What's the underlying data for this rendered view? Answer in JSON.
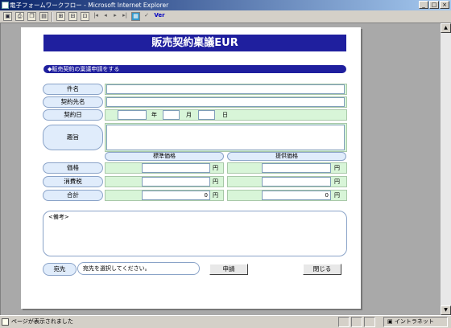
{
  "window": {
    "title": "電子フォームワークフロー - Microsoft Internet Explorer",
    "buttons": [
      "_",
      "□",
      "×"
    ]
  },
  "toolbar": {
    "zoom_version_label": "Ver",
    "icons": [
      "save-icon",
      "print-icon",
      "copy-icon",
      "paste-icon",
      "fit-page-icon",
      "fit-width-icon",
      "zoom-icon",
      "first-page-icon",
      "prev-page-icon",
      "next-page-icon",
      "last-page-icon",
      "image-icon",
      "check-icon"
    ]
  },
  "form": {
    "title": "販売契約稟議EUR",
    "section_header": "◆販売契約の稟議申請をする",
    "labels": {
      "subject": "件名",
      "contract_party": "契約先名",
      "contract_date": "契約日",
      "purpose": "趣旨",
      "price": "価格",
      "consumption_tax": "消費税",
      "total": "合計"
    },
    "date_units": {
      "year": "年",
      "month": "月",
      "day": "日"
    },
    "column_headers": {
      "standard_price": "標準価格",
      "offered_price": "提供価格"
    },
    "currency_unit": "円",
    "values": {
      "subject": "",
      "contract_party": "",
      "contract_date_year": "",
      "contract_date_month": "",
      "contract_date_day": "",
      "purpose": "",
      "standard_price": "",
      "standard_tax": "",
      "standard_total": "0",
      "offered_price": "",
      "offered_tax": "",
      "offered_total": "0"
    },
    "remarks_label": "<備考>",
    "destination_label": "宛先",
    "destination_placeholder": "宛先を選択してください。",
    "apply_button": "申請",
    "close_button": "閉じる"
  },
  "status": {
    "text": "ページが表示されました",
    "zone": "イントラネット"
  }
}
